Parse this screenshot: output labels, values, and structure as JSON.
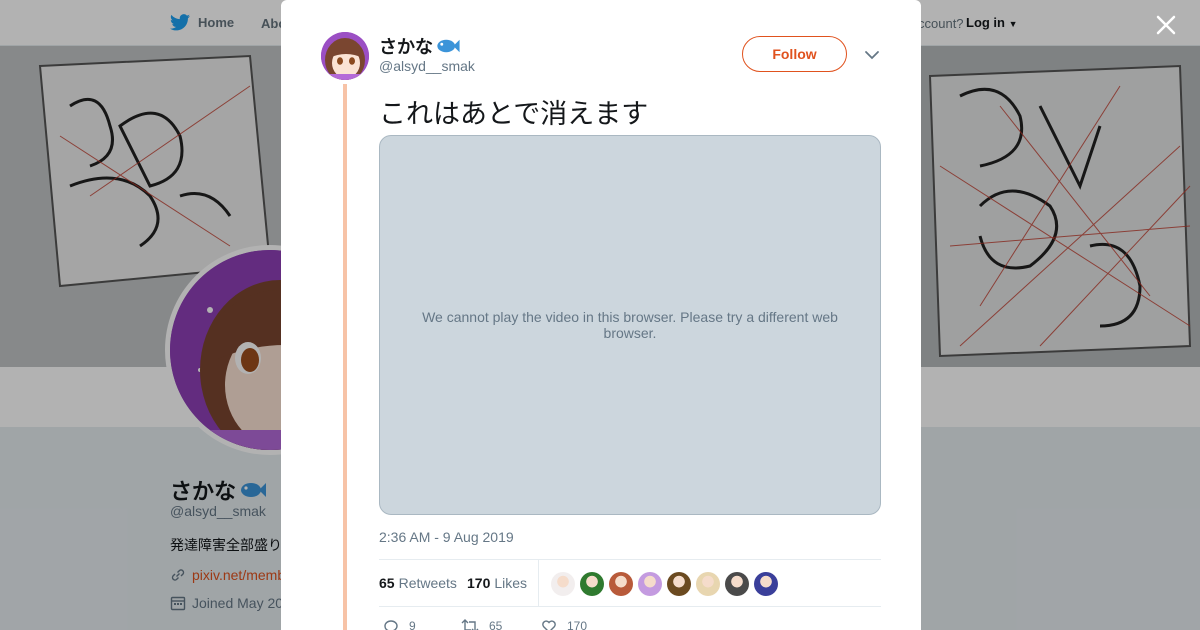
{
  "background": {
    "nav": {
      "home_label": "Home",
      "about_label": "Abo",
      "account_prompt": "ccount?",
      "login_label": "Log in"
    },
    "profile": {
      "display_name": "さかな",
      "handle": "@alsyd__smak",
      "bio": "発達障害全部盛り",
      "link": "pixiv.net/memb",
      "joined": "Joined May 20"
    }
  },
  "tweet": {
    "author": {
      "display_name": "さかな",
      "handle": "@alsyd__smak",
      "emoji_icon": "fish-icon"
    },
    "follow_label": "Follow",
    "text": "これはあとで消えます",
    "video_message": "We cannot play the video in this browser. Please try a different web browser.",
    "timestamp": "2:36 AM - 9 Aug 2019",
    "stats": {
      "retweets_count": "65",
      "retweets_label": "Retweets",
      "likes_count": "170",
      "likes_label": "Likes"
    },
    "liker_avatars": [
      "#f2eeee",
      "#2f7a2f",
      "#b85a3a",
      "#c49be0",
      "#6b4a20",
      "#e8d6b0",
      "#4a4a4a",
      "#3a3f9a"
    ],
    "actions": {
      "reply_count": "9",
      "retweet_count": "65",
      "like_count": "170"
    }
  },
  "colors": {
    "accent": "#e0521e",
    "thread_line": "#f7c3a7",
    "video_bg": "#ccd6dd"
  }
}
